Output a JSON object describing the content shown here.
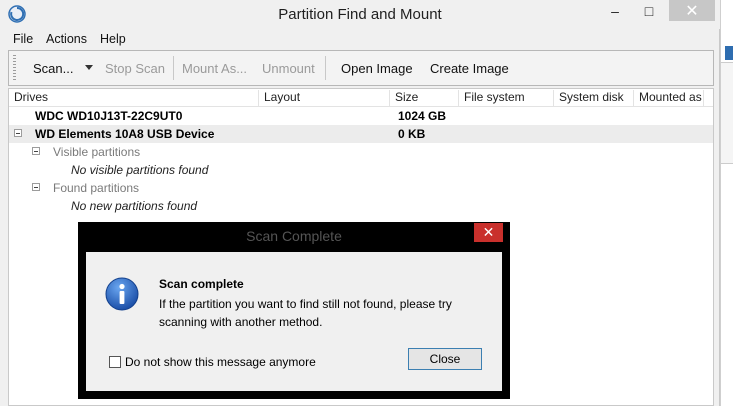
{
  "window": {
    "title": "Partition Find and Mount",
    "minimize": "–",
    "maximize": "□",
    "close": "✕"
  },
  "menu": [
    "File",
    "Actions",
    "Help"
  ],
  "toolbar": {
    "scan": "Scan...",
    "stop_scan": "Stop Scan",
    "mount_as": "Mount As...",
    "unmount": "Unmount",
    "open_image": "Open Image",
    "create_image": "Create Image"
  },
  "columns": [
    "Drives",
    "Layout",
    "Size",
    "File system",
    "System disk",
    "Mounted as"
  ],
  "rows": {
    "drive1": {
      "name": "WDC WD10J13T-22C9UT0",
      "size": "1024 GB"
    },
    "drive2": {
      "name": "WD Elements 10A8 USB Device",
      "size": "0 KB"
    },
    "visible_partitions": "Visible partitions",
    "no_visible": "No visible partitions found",
    "found_partitions": "Found partitions",
    "no_new": "No new partitions found"
  },
  "dialog": {
    "title": "Scan Complete",
    "close_x": "✕",
    "heading": "Scan complete",
    "message": "If the partition you want to find still not found, please try scanning with another method.",
    "checkbox_label": "Do not show this message anymore",
    "checkbox_checked": false,
    "close_button": "Close",
    "icon": "info-icon"
  },
  "colors": {
    "close_red": "#c9302c",
    "info_blue": "#1f5fbf"
  }
}
